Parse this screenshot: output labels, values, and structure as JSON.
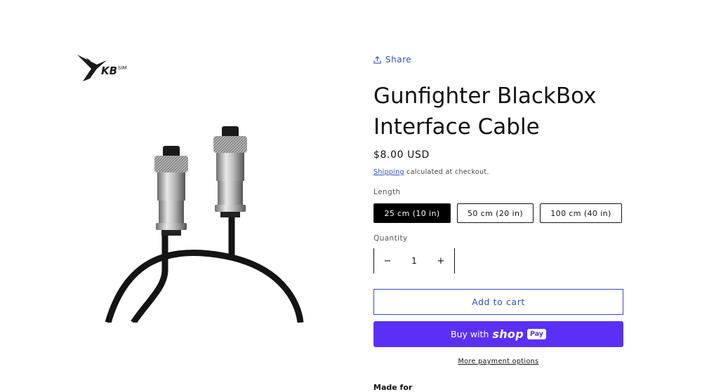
{
  "product": {
    "title": "Gunfighter BlackBox Interface Cable",
    "price": "$8.00 USD",
    "share_label": "Share",
    "shipping_link": "Shipping",
    "shipping_note": " calculated at checkout.",
    "image_alt": "Black interface cable with two metal circular connectors"
  },
  "brand": {
    "logo_text": "KB SIM"
  },
  "variants": {
    "label": "Length",
    "options": [
      "25 cm (10 in)",
      "50 cm (20 in)",
      "100 cm (40 in)"
    ],
    "selected": "25 cm (10 in)"
  },
  "quantity": {
    "label": "Quantity",
    "value": "1",
    "decrease": "−",
    "increase": "+"
  },
  "actions": {
    "add_to_cart": "Add to cart",
    "buy_with": "Buy with",
    "shop_word": "shop",
    "pay_badge": "Pay",
    "more_payment": "More payment options"
  },
  "description": {
    "heading": "Made for"
  },
  "colors": {
    "accent": "#334fb4",
    "shop_pay": "#5a31f4",
    "text": "#121212"
  }
}
